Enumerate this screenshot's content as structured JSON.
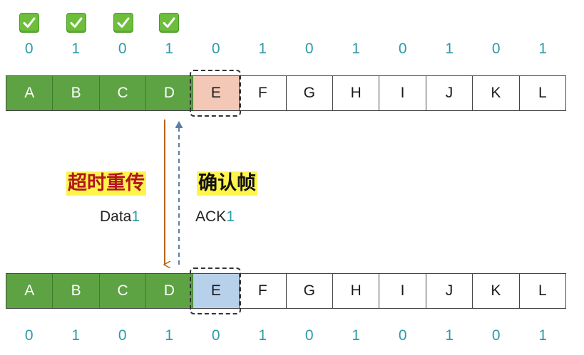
{
  "top": {
    "checks": [
      "check",
      "check",
      "check",
      "check"
    ],
    "sequence": [
      "0",
      "1",
      "0",
      "1",
      "0",
      "1",
      "0",
      "1",
      "0",
      "1",
      "0",
      "1"
    ],
    "frames": [
      "A",
      "B",
      "C",
      "D",
      "E",
      "F",
      "G",
      "H",
      "I",
      "J",
      "K",
      "L"
    ]
  },
  "bottom": {
    "frames": [
      "A",
      "B",
      "C",
      "D",
      "E",
      "F",
      "G",
      "H",
      "I",
      "J",
      "K",
      "L"
    ],
    "sequence": [
      "0",
      "1",
      "0",
      "1",
      "0",
      "1",
      "0",
      "1",
      "0",
      "1",
      "0",
      "1"
    ]
  },
  "labels": {
    "timeout_retransmit": "超时重传",
    "ack_frame": "确认帧",
    "data_text": "Data",
    "data_num": "1",
    "ack_text": "ACK",
    "ack_num": "1"
  },
  "colors": {
    "acked": "#5da343",
    "pending_top": "#f4c8b6",
    "pending_bottom": "#b7d1ea",
    "seq": "#2c9aa8",
    "data_arrow": "#b5651d",
    "ack_arrow": "#5b7fa6"
  }
}
